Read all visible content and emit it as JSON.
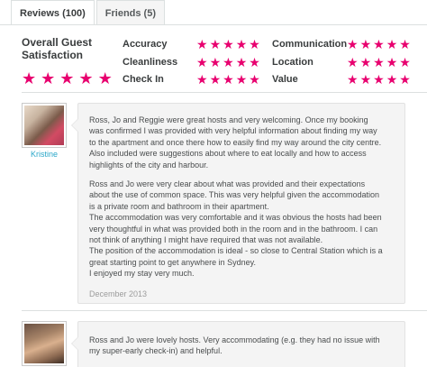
{
  "tabs": [
    {
      "label": "Reviews (100)",
      "active": true
    },
    {
      "label": "Friends (5)",
      "active": false
    }
  ],
  "summary": {
    "title_line1": "Overall Guest",
    "title_line2": "Satisfaction",
    "overall_rating": 5,
    "star_glyph": "★",
    "star_color": "#e8006f",
    "categories": [
      {
        "label": "Accuracy",
        "rating": 5
      },
      {
        "label": "Cleanliness",
        "rating": 5
      },
      {
        "label": "Check In",
        "rating": 5
      },
      {
        "label": "Communication",
        "rating": 5
      },
      {
        "label": "Location",
        "rating": 5
      },
      {
        "label": "Value",
        "rating": 5
      }
    ]
  },
  "reviews": [
    {
      "name": "Kristine",
      "avatar": "reviewer-photo",
      "paragraphs": [
        "Ross, Jo and Reggie were great hosts and very welcoming. Once my booking\nwas confirmed I was provided with very helpful information about finding my way\nto the apartment and once there how to easily find my way around the city centre.\nAlso included were suggestions about where to eat locally and how to access\nhighlights of the city and harbour.",
        "Ross and Jo were very clear about what was provided and their expectations\nabout the use of common space. This was very helpful given the accommodation\nis a private room and bathroom in their apartment.\nThe accommodation was very comfortable and it was obvious the hosts had been\nvery thoughtful in what was provided both in the room and in the bathroom. I can\nnot think of anything I might have required that was not available.\nThe position of the accommodation is ideal - so close to Central Station which is a\ngreat starting point to get anywhere in Sydney.\nI enjoyed my stay very much."
      ],
      "date": "December 2013"
    },
    {
      "name": "",
      "avatar": "reviewer-photo",
      "paragraphs": [
        "Ross and Jo were lovely hosts. Very accommodating (e.g. they had no issue with\nmy super-early check-in) and helpful."
      ],
      "date": ""
    }
  ]
}
